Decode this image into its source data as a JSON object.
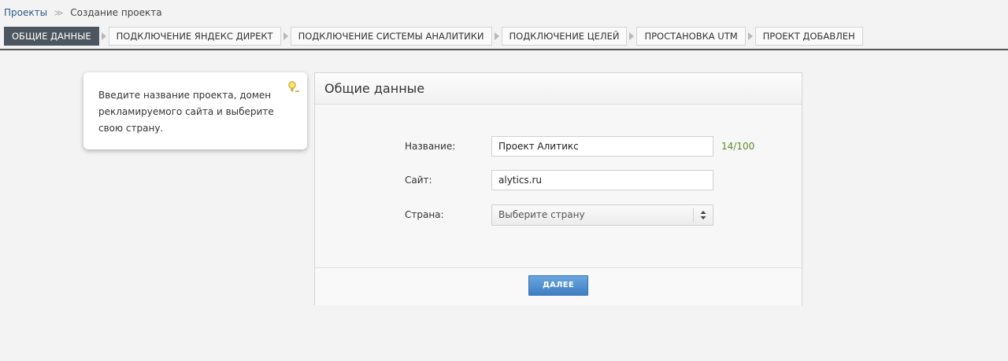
{
  "breadcrumb": {
    "items": [
      "Проекты",
      "Создание проекта"
    ],
    "separator": "≫"
  },
  "steps": [
    {
      "label": "Общие данные",
      "active": true
    },
    {
      "label": "Подключение Яндекс Директ",
      "active": false
    },
    {
      "label": "Подключение системы аналитики",
      "active": false
    },
    {
      "label": "Подключение целей",
      "active": false
    },
    {
      "label": "Простановка UTM",
      "active": false
    },
    {
      "label": "Проект добавлен",
      "active": false
    }
  ],
  "tip": {
    "text": "Введите название проекта, домен рекламируемого сайта и выберите свою страну.",
    "icon": "lightbulb-icon"
  },
  "panel": {
    "title": "Общие данные",
    "fields": {
      "name": {
        "label": "Название:",
        "value": "Проект Алитикс",
        "counter": "14/100"
      },
      "site": {
        "label": "Сайт:",
        "value": "alytics.ru"
      },
      "country": {
        "label": "Страна:",
        "selected": "Выберите страну"
      }
    },
    "next_button": "ДАЛЕЕ"
  },
  "colors": {
    "active_step_bg": "#4c5660",
    "button_blue": "#4a8ad0",
    "counter_green": "#5a8a2a",
    "link_blue": "#2a5a8a"
  }
}
